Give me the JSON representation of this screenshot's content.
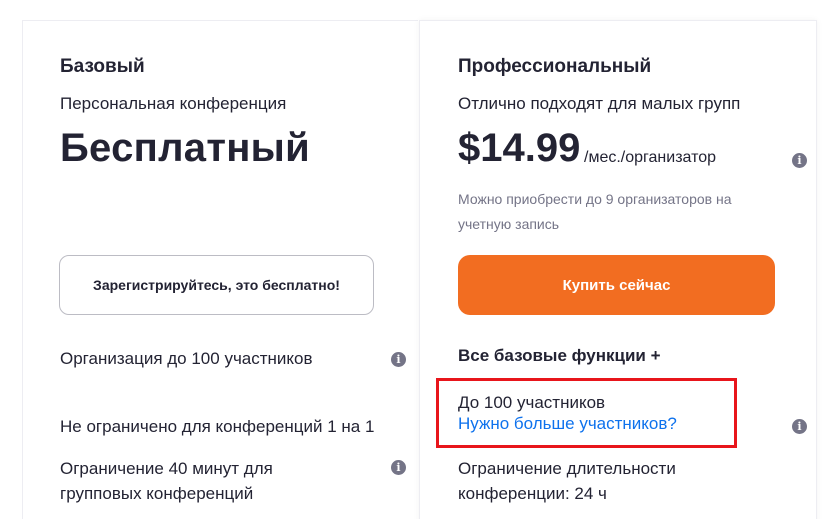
{
  "basic": {
    "name": "Базовый",
    "subtitle": "Персональная конференция",
    "price": "Бесплатный",
    "button_label": "Зарегистрируйтесь, это бесплатно!",
    "features": [
      "Организация до 100 участников",
      "Не ограничено для конференций 1 на 1",
      "Ограничение 40 минут для групповых конференций"
    ]
  },
  "pro": {
    "name": "Профессиональный",
    "subtitle": "Отлично подходят для малых групп",
    "price": "$14.99",
    "price_unit": "/мес./организатор",
    "note": "Можно приобрести до 9 организаторов на учетную запись",
    "button_label": "Купить сейчас",
    "features_header": "Все базовые функции +",
    "participants": "До 100 участников",
    "more_link": "Нужно больше участников?",
    "duration": "Ограничение длительности конференции: 24 ч"
  },
  "icons": {
    "info_glyph": "i"
  },
  "colors": {
    "accent_orange": "#f26d21",
    "link_blue": "#0e72ed",
    "highlight_red": "#e8151b",
    "text_dark": "#232333",
    "text_muted": "#747487"
  }
}
